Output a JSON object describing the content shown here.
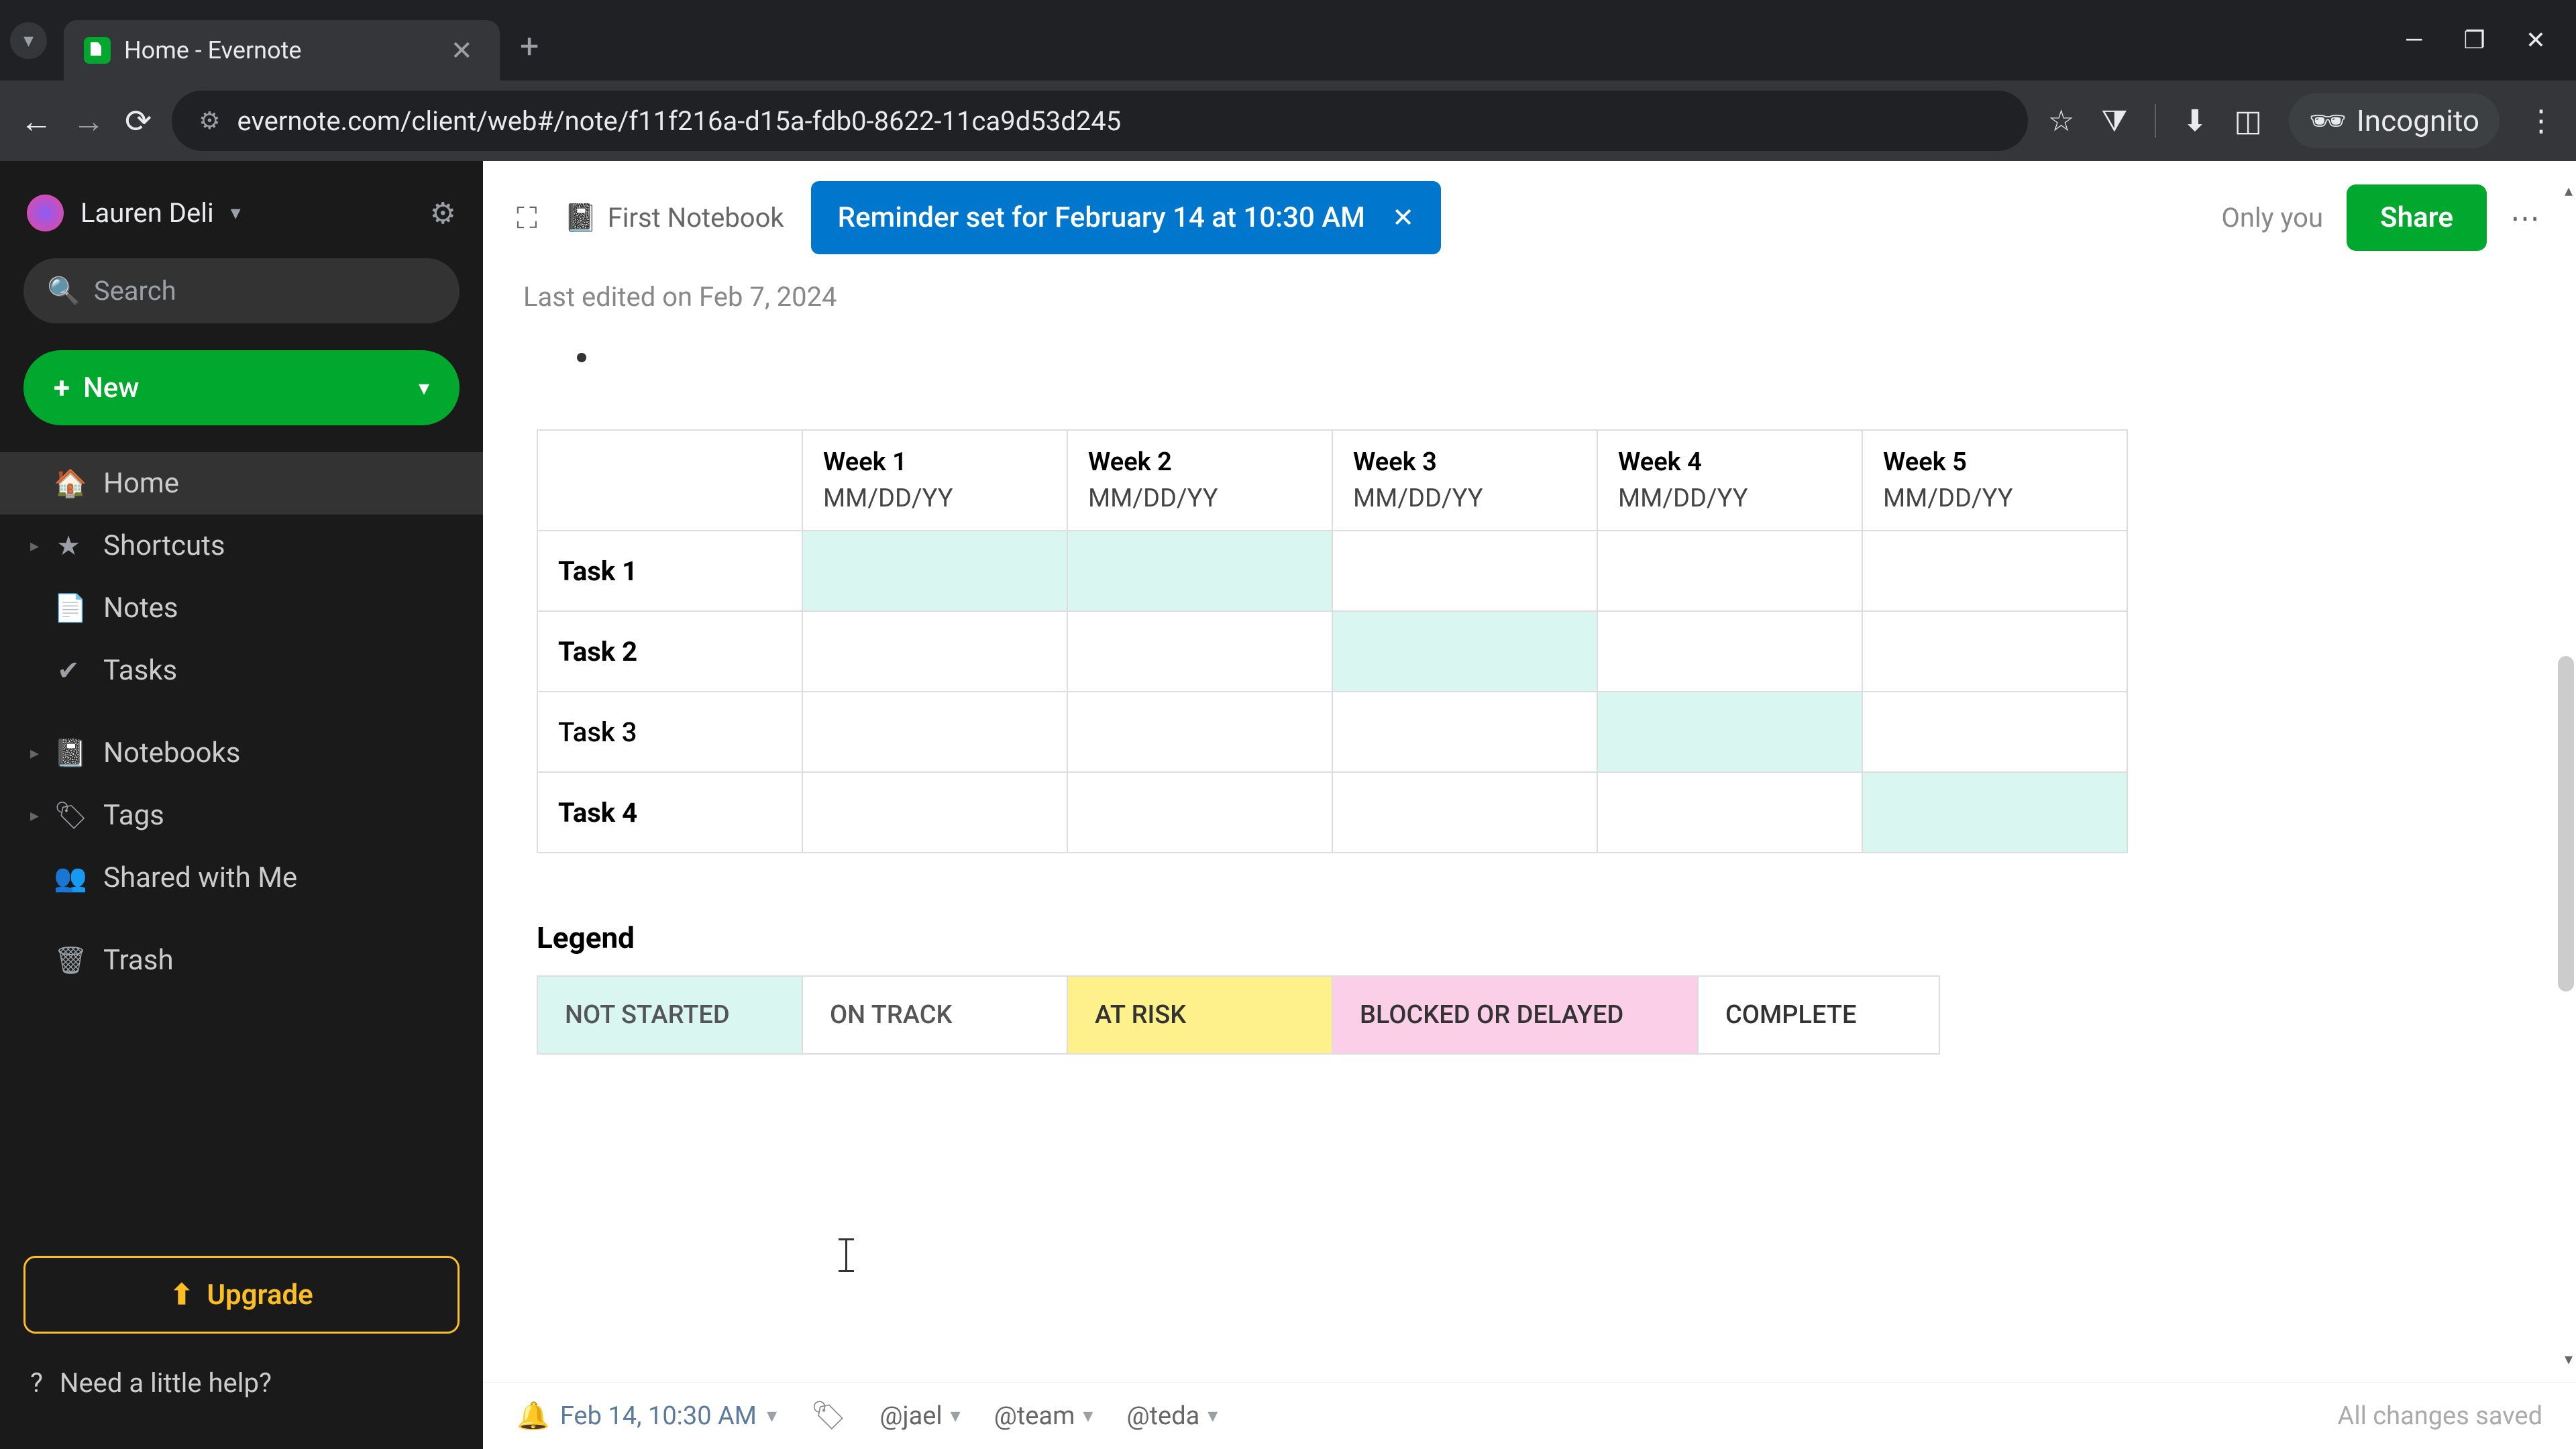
{
  "browser": {
    "tab_title": "Home - Evernote",
    "url": "evernote.com/client/web#/note/f11f216a-d15a-fdb0-8622-11ca9d53d245",
    "incognito_label": "Incognito"
  },
  "sidebar": {
    "username": "Lauren Deli",
    "search_placeholder": "Search",
    "new_label": "New",
    "nav": {
      "home": "Home",
      "shortcuts": "Shortcuts",
      "notes": "Notes",
      "tasks": "Tasks",
      "notebooks": "Notebooks",
      "tags": "Tags",
      "shared": "Shared with Me",
      "trash": "Trash"
    },
    "upgrade_label": "Upgrade",
    "help_label": "Need a little help?"
  },
  "note": {
    "notebook": "First Notebook",
    "reminder_toast": "Reminder set for February 14 at 10:30 AM",
    "only_you": "Only you",
    "share_label": "Share",
    "last_edited": "Last edited on Feb 7, 2024",
    "gantt": {
      "weeks": [
        {
          "label": "Week 1",
          "sub": "MM/DD/YY"
        },
        {
          "label": "Week 2",
          "sub": "MM/DD/YY"
        },
        {
          "label": "Week 3",
          "sub": "MM/DD/YY"
        },
        {
          "label": "Week 4",
          "sub": "MM/DD/YY"
        },
        {
          "label": "Week 5",
          "sub": "MM/DD/YY"
        }
      ],
      "tasks": [
        {
          "label": "Task 1",
          "fill": [
            true,
            true,
            false,
            false,
            false
          ]
        },
        {
          "label": "Task 2",
          "fill": [
            false,
            false,
            true,
            false,
            false
          ]
        },
        {
          "label": "Task 3",
          "fill": [
            false,
            false,
            false,
            true,
            false
          ]
        },
        {
          "label": "Task 4",
          "fill": [
            false,
            false,
            false,
            false,
            true
          ]
        }
      ]
    },
    "legend_title": "Legend",
    "legend": {
      "not_started": "NOT STARTED",
      "on_track": "ON TRACK",
      "at_risk": "AT RISK",
      "blocked": "BLOCKED OR DELAYED",
      "complete": "COMPLETE"
    }
  },
  "footer": {
    "reminder_date": "Feb 14, 10:30 AM",
    "mentions": [
      "@jael",
      "@team",
      "@teda"
    ],
    "saved_status": "All changes saved"
  }
}
